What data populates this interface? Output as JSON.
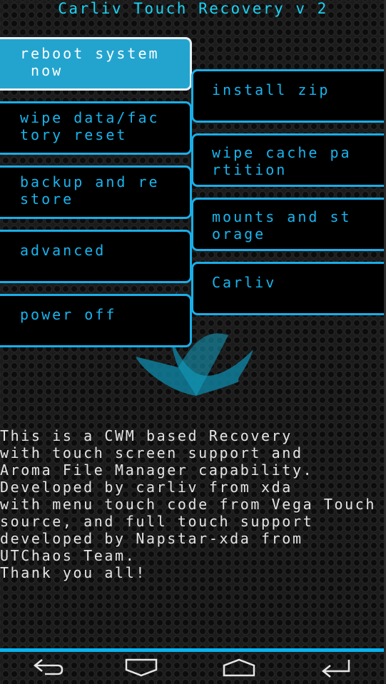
{
  "header": {
    "title": "Carliv Touch Recovery v 2"
  },
  "menu": {
    "left": [
      {
        "label": "reboot system\n now",
        "selected": true
      },
      {
        "label": "wipe data/fac\ntory reset",
        "selected": false
      },
      {
        "label": "backup and re\nstore",
        "selected": false
      },
      {
        "label": "advanced",
        "selected": false
      },
      {
        "label": "power off",
        "selected": false
      }
    ],
    "right": [
      {
        "label": "install zip"
      },
      {
        "label": "wipe cache pa\nrtition"
      },
      {
        "label": "mounts and st\norage"
      },
      {
        "label": "Carliv"
      }
    ]
  },
  "info_text": "This is a CWM based Recovery\nwith touch screen support and\nAroma File Manager capability.\nDeveloped by carliv from xda\nwith menu touch code from Vega Touch\nsource, and full touch support\ndeveloped by Napstar-xda from\nUTChaos Team.\nThank you all!",
  "navbar": {
    "buttons": [
      {
        "icon": "back-icon"
      },
      {
        "icon": "down-icon"
      },
      {
        "icon": "up-home-icon"
      },
      {
        "icon": "enter-icon"
      }
    ]
  },
  "colors": {
    "accent": "#1aaee8",
    "selected_bg": "#23a4cf",
    "title": "#19d3f5",
    "nav_line": "#06b4f0"
  }
}
